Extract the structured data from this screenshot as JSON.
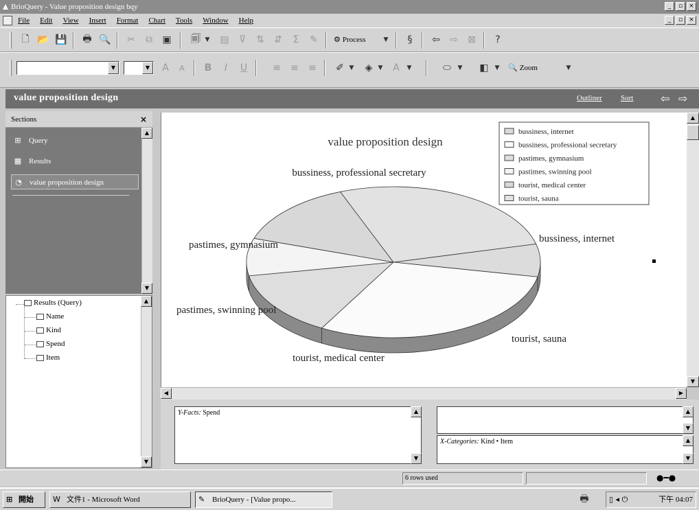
{
  "window": {
    "title": "BrioQuery - Value proposition design bqy",
    "controls": [
      "_",
      "▫",
      "×"
    ]
  },
  "menu": [
    "File",
    "Edit",
    "View",
    "Insert",
    "Format",
    "Chart",
    "Tools",
    "Window",
    "Help"
  ],
  "toolbar": {
    "process_label": "Process",
    "zoom_label": "Zoom"
  },
  "section_header": {
    "title": "value proposition design",
    "outliner": "Outliner",
    "sort": "Sort"
  },
  "sections_panel": {
    "title": "Sections",
    "close": "×",
    "items": [
      "Query",
      "Results",
      "value proposition design"
    ]
  },
  "tree": {
    "root": "Results (Query)",
    "children": [
      "Name",
      "Kind",
      "Spend",
      "Item"
    ]
  },
  "chart_data": {
    "type": "pie",
    "title": "value proposition design",
    "categories": [
      "bussiness, internet",
      "bussiness, professional secretary",
      "pastimes, gymnasium",
      "pastimes, swinning pool",
      "tourist, medical center",
      "tourist, sauna"
    ],
    "legend": [
      "bussiness, internet",
      "bussiness, professional secretary",
      "pastimes, gymnasium",
      "pastimes, swinning pool",
      "tourist, medical center",
      "tourist, sauna"
    ],
    "values": [
      7,
      30,
      14,
      8,
      14,
      27
    ],
    "legend_position": "top-right",
    "three_d": true
  },
  "zones": {
    "y_facts_label": "Y-Facts:",
    "y_facts_value": "Spend",
    "x_categories_label": "X-Categories:",
    "x_categories_value": "Kind • Item"
  },
  "status": {
    "rows": "6 rows used"
  },
  "taskbar": {
    "start": "開始",
    "tasks": [
      "文件1 - Microsoft Word",
      "BrioQuery - [Value propo..."
    ],
    "clock": "下午 04:07"
  },
  "colors": {
    "section_bar": "#6e6e6e",
    "sections_bg": "#7a7a7a",
    "face": "#d4d4d4"
  }
}
